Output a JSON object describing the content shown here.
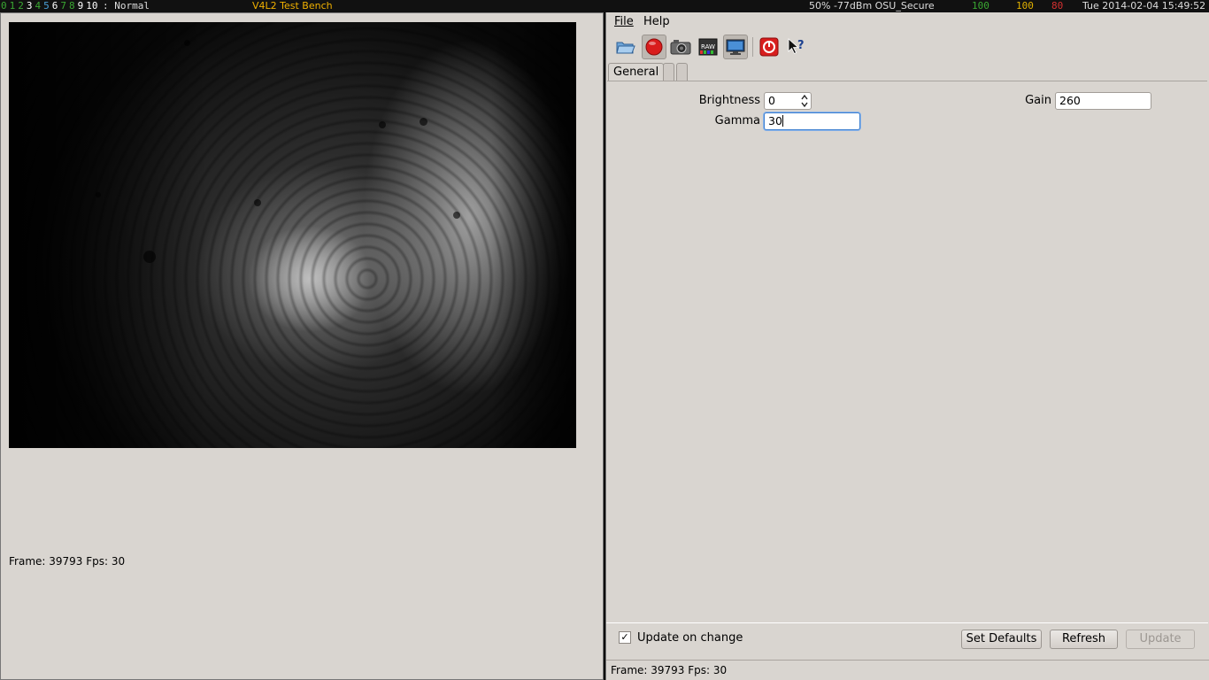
{
  "topbar": {
    "workspaces": [
      {
        "label": "0",
        "color": "#3aa832"
      },
      {
        "label": "1",
        "color": "#3aa832"
      },
      {
        "label": "2",
        "color": "#3aa832"
      },
      {
        "label": "3",
        "color": "#ffffff"
      },
      {
        "label": "4",
        "color": "#3aa832"
      },
      {
        "label": "5",
        "color": "#4aa0d8"
      },
      {
        "label": "6",
        "color": "#ffffff"
      },
      {
        "label": "7",
        "color": "#3aa832"
      },
      {
        "label": "8",
        "color": "#3aa832"
      },
      {
        "label": "9",
        "color": "#ffffff"
      },
      {
        "label": "10",
        "color": "#ffffff"
      }
    ],
    "layout": ": Normal",
    "window_title": "V4L2 Test Bench",
    "wifi": "50% -77dBm OSU_Secure",
    "cpu": "100",
    "mem": "100",
    "battery": "80",
    "clock": "Tue 2014-02-04 15:49:52"
  },
  "left": {
    "status": "Frame: 39793 Fps: 30"
  },
  "right": {
    "menu": {
      "file": "File",
      "help": "Help"
    },
    "toolbar_icons": [
      "open-icon",
      "record-icon",
      "camera-icon",
      "raw-icon",
      "display-icon",
      "power-icon",
      "whats-this-icon"
    ],
    "tabs": [
      "General",
      "",
      ""
    ],
    "controls": {
      "brightness_label": "Brightness",
      "brightness_value": "0",
      "gain_label": "Gain",
      "gain_value": "260",
      "gamma_label": "Gamma",
      "gamma_value": "30"
    },
    "update_on_change_label": "Update on change",
    "update_on_change_checked": "✓",
    "buttons": {
      "set_defaults": "Set Defaults",
      "refresh": "Refresh",
      "update": "Update"
    },
    "status": "Frame: 39793 Fps: 30"
  }
}
